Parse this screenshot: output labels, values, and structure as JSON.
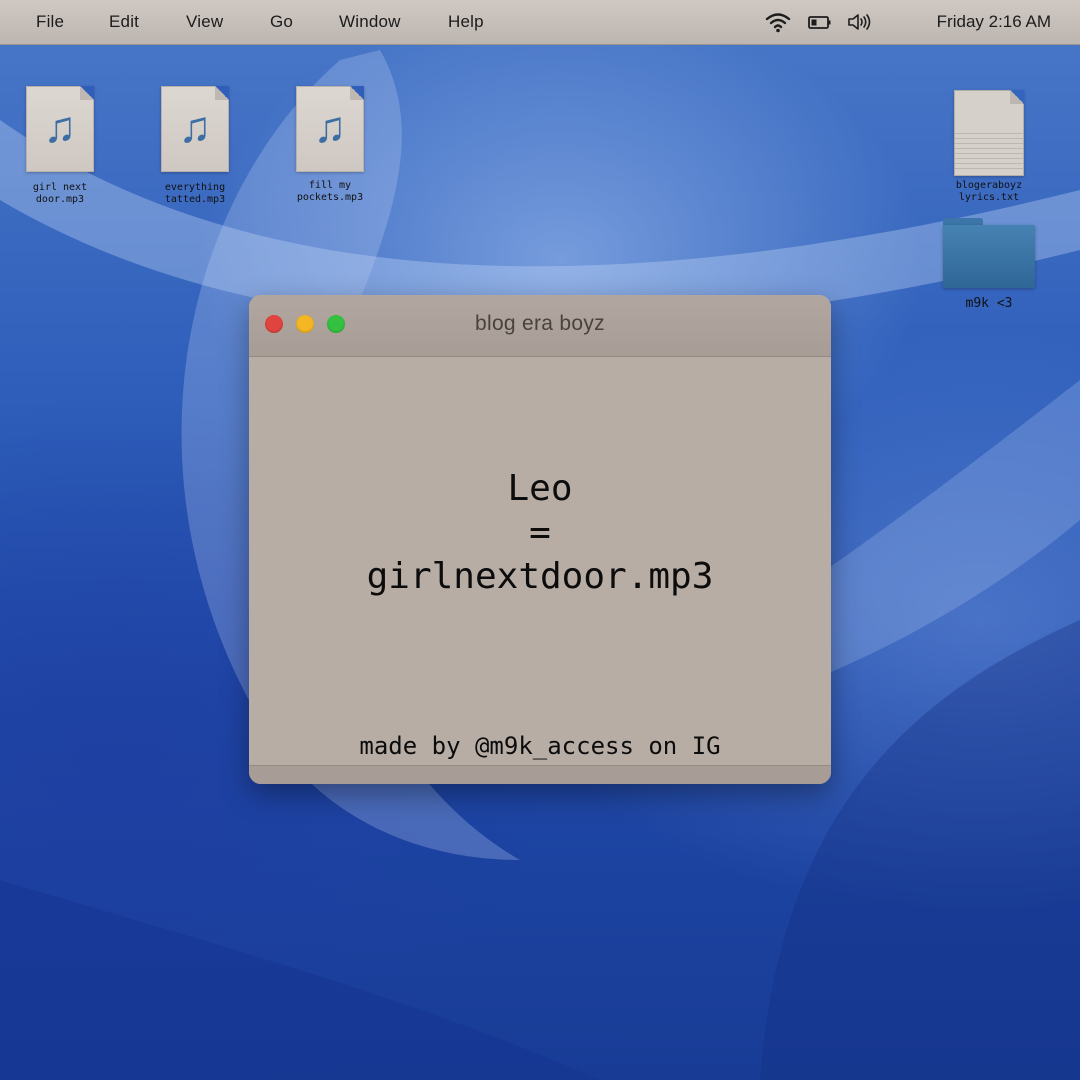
{
  "menubar": {
    "items": [
      "File",
      "Edit",
      "View",
      "Go",
      "Window",
      "Help"
    ],
    "clock": "Friday 2:16 AM",
    "status_icons": [
      "wifi-icon",
      "battery-icon",
      "volume-icon"
    ]
  },
  "desktop": {
    "icons": [
      {
        "label": "girl next\ndoor.mp3",
        "type": "music-file"
      },
      {
        "label": "everything\ntatted.mp3",
        "type": "music-file"
      },
      {
        "label": "fill my\npockets.mp3",
        "type": "music-file"
      },
      {
        "label": "blogeraboyz\nlyrics.txt",
        "type": "text-file"
      },
      {
        "label": "m9k <3",
        "type": "folder"
      }
    ]
  },
  "window": {
    "title": "blog era boyz",
    "line1": "Leo",
    "line2": "=",
    "line3": "girlnextdoor.mp3",
    "credit": "made by @m9k_access on IG",
    "buttons": [
      "close",
      "minimize",
      "zoom"
    ]
  },
  "colors": {
    "close": "#e0443e",
    "minimize": "#f4b623",
    "zoom": "#34c13f",
    "music_note": "#3c6ea3",
    "folder": "#3a74a6"
  }
}
